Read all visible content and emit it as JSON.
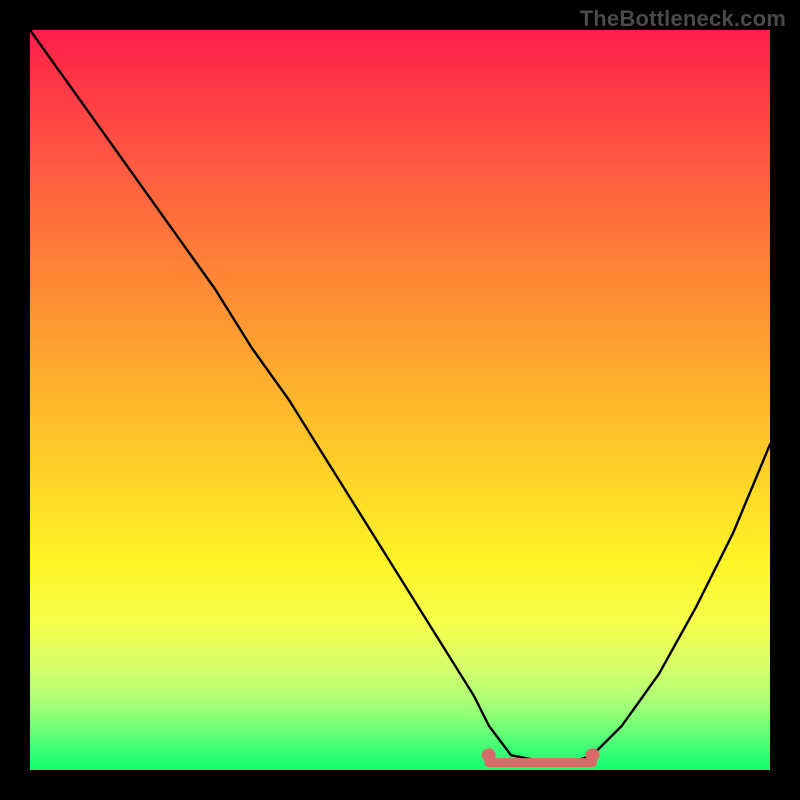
{
  "watermark": "TheBottleneck.com",
  "chart_data": {
    "type": "line",
    "title": "",
    "xlabel": "",
    "ylabel": "",
    "xlim": [
      0,
      100
    ],
    "ylim": [
      0,
      100
    ],
    "grid": false,
    "legend": false,
    "series": [
      {
        "name": "bottleneck-curve",
        "color": "#000000",
        "x": [
          0,
          5,
          10,
          15,
          20,
          25,
          30,
          35,
          40,
          45,
          50,
          55,
          60,
          62,
          65,
          70,
          73,
          76,
          80,
          85,
          90,
          95,
          100
        ],
        "y": [
          100,
          93,
          86,
          79,
          72,
          65,
          57,
          50,
          42,
          34,
          26,
          18,
          10,
          6,
          2,
          1,
          1,
          2,
          6,
          13,
          22,
          32,
          44
        ]
      },
      {
        "name": "optimal-flat-segment",
        "color": "#d86a6a",
        "x": [
          62,
          76
        ],
        "y": [
          1,
          1
        ]
      }
    ],
    "markers": [
      {
        "name": "optimal-start",
        "x": 62,
        "y": 2,
        "color": "#d86a6a"
      },
      {
        "name": "optimal-end",
        "x": 76,
        "y": 2,
        "color": "#d86a6a"
      }
    ],
    "gradient_stops": [
      {
        "pct": 0,
        "color": "#ff1e4b"
      },
      {
        "pct": 18,
        "color": "#ff5942"
      },
      {
        "pct": 46,
        "color": "#ffab2e"
      },
      {
        "pct": 72,
        "color": "#fff427"
      },
      {
        "pct": 91,
        "color": "#a7ff77"
      },
      {
        "pct": 100,
        "color": "#14ff70"
      }
    ]
  }
}
